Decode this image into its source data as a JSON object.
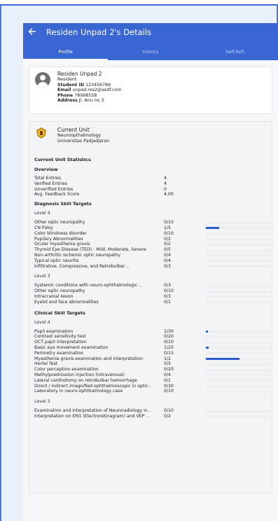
{
  "app_title": "Residen Unpad 2's Details",
  "tabs": [
    {
      "label": "Profile",
      "active": true
    },
    {
      "label": "History",
      "active": false
    },
    {
      "label": "Self-Refl.",
      "active": false
    }
  ],
  "profile": {
    "name": "Residen Unpad 2",
    "role": "Resident",
    "student_id_label": "Student ID",
    "student_id": "123456789",
    "email_label": "Email",
    "email": "unpad.res2@asdf.com",
    "phone_label": "Phone",
    "phone": "78998558",
    "address_label": "Address",
    "address": "Jl. Anu no 3"
  },
  "unit": {
    "title": "Current Unit",
    "name": "Neuroopthalmology",
    "university": "Universitas Padjadjaran"
  },
  "stats": {
    "heading": "Current Unit Statistics",
    "overview_heading": "Overview",
    "rows": [
      {
        "label": "Total Entries",
        "value": "4"
      },
      {
        "label": "Verified Entries",
        "value": "4"
      },
      {
        "label": "Unverified Entries",
        "value": "0"
      },
      {
        "label": "Avg. Feedback Score",
        "value": "4.00"
      }
    ]
  },
  "diagnosis": {
    "heading": "Diagnosis Skill Targets",
    "levels": [
      {
        "label": "Level 4",
        "items": [
          {
            "label": "Other optic neuropathy",
            "value": "0/10",
            "progress": 0
          },
          {
            "label": "CN Palsy",
            "value": "1/5",
            "progress": 0.2
          },
          {
            "label": "Color blindness disorder",
            "value": "0/10",
            "progress": 0
          },
          {
            "label": "Pupilary Abnormalities",
            "value": "0/2",
            "progress": 0
          },
          {
            "label": "Ocular myasthenia gravis",
            "value": "0/2",
            "progress": 0
          },
          {
            "label": "Thyroid Eye Disease (TED) - Mild, Moderate, Severe",
            "value": "0/5",
            "progress": 0
          },
          {
            "label": "Non-arthritic ischemic optic neuropathy",
            "value": "0/4",
            "progress": 0
          },
          {
            "label": "Typical optic neuritis",
            "value": "0/4",
            "progress": 0
          },
          {
            "label": "Infiltrative, Compressive, and Retrobulbar ..",
            "value": "0/3",
            "progress": 0
          }
        ]
      },
      {
        "label": "Level 3",
        "items": [
          {
            "label": "Systemic conditions with neuro-ophthalmologic ..",
            "value": "0/3",
            "progress": 0
          },
          {
            "label": "Other optic neuropathy",
            "value": "0/10",
            "progress": 0
          },
          {
            "label": "Intracranial lesion",
            "value": "0/3",
            "progress": 0
          },
          {
            "label": "Eyelid and face abnormalities",
            "value": "0/1",
            "progress": 0
          }
        ]
      }
    ]
  },
  "clinical": {
    "heading": "Clinical Skill Targets",
    "levels": [
      {
        "label": "Level 4",
        "items": [
          {
            "label": "Pupil examination",
            "value": "1/30",
            "progress": 0.033
          },
          {
            "label": "Contrast sensitivity test",
            "value": "0/20",
            "progress": 0
          },
          {
            "label": "OCT papil interpretation",
            "value": "0/10",
            "progress": 0
          },
          {
            "label": "Basic eye movement examination",
            "value": "1/25",
            "progress": 0.04
          },
          {
            "label": "Perimetry examination",
            "value": "0/15",
            "progress": 0
          },
          {
            "label": "Myasthenia gravis examination and interpretation",
            "value": "1/2",
            "progress": 0.5
          },
          {
            "label": "Hertel Test",
            "value": "0/5",
            "progress": 0
          },
          {
            "label": "Color perception examination",
            "value": "0/20",
            "progress": 0
          },
          {
            "label": "Methylprednisolon injection (intravenous)",
            "value": "0/4",
            "progress": 0
          },
          {
            "label": "Lateral canthotomy on retrobulbar hemorrhage",
            "value": "0/1",
            "progress": 0
          },
          {
            "label": "Direct / indirect /magnified ophthalmoscopic in optic..",
            "value": "0/30",
            "progress": 0
          },
          {
            "label": "Laboratory in neuro-ophthalmology case",
            "value": "0/10",
            "progress": 0
          }
        ]
      },
      {
        "label": "Level 3",
        "items": [
          {
            "label": "Examination and interpretation of Neuroradiology in ..",
            "value": "0/10",
            "progress": 0
          },
          {
            "label": "Interpretation on ERG (Electroretinagram) and VEP ..",
            "value": "0/2",
            "progress": 0
          }
        ]
      }
    ]
  },
  "icons": {
    "back": "arrow-left-icon",
    "avatar": "person-avatar-icon",
    "logo": "university-logo"
  },
  "colors": {
    "appbar": "#3a66d3",
    "progress": "#2e5ccf"
  }
}
